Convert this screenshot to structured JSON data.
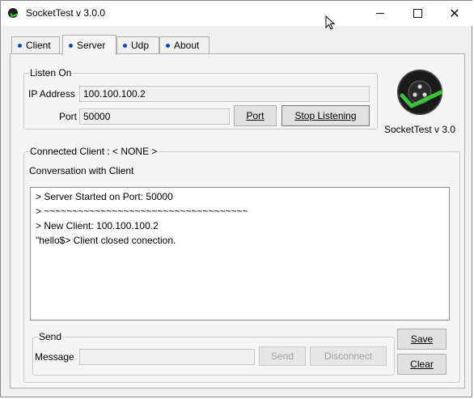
{
  "window": {
    "title": "SocketTest v 3.0.0",
    "controls": {
      "minimize": "minimize-icon",
      "maximize": "maximize-icon",
      "close": "✕"
    }
  },
  "tabs": [
    {
      "label": "Client",
      "active": false
    },
    {
      "label": "Server",
      "active": true
    },
    {
      "label": "Udp",
      "active": false
    },
    {
      "label": "About",
      "active": false
    }
  ],
  "listen_on": {
    "title": "Listen On",
    "ip_label": "IP Address",
    "ip_value": "100.100.100.2",
    "port_label": "Port",
    "port_value": "50000",
    "port_button": "Port",
    "stop_button": "Stop Listening"
  },
  "logo": {
    "caption": "SocketTest v 3.0",
    "icon": "sockettest-logo-icon"
  },
  "connected": {
    "title": "Connected Client : < NONE >",
    "conversation_label": "Conversation with Client",
    "log": [
      "> Server Started on Port: 50000",
      "> ~~~~~~~~~~~~~~~~~~~~~~~~~~~~~~~~~~~~",
      "> New Client: 100.100.100.2",
      "\"hello$> Client closed conection."
    ]
  },
  "send": {
    "title": "Send",
    "message_label": "Message",
    "message_value": "",
    "send_button": "Send",
    "disconnect_button": "Disconnect"
  },
  "actions": {
    "save_button": "Save",
    "clear_button": "Clear"
  },
  "colors": {
    "tab_dot": "#1f3fbf",
    "logo_check": "#3bc43b",
    "logo_body": "#1a1a1a"
  }
}
